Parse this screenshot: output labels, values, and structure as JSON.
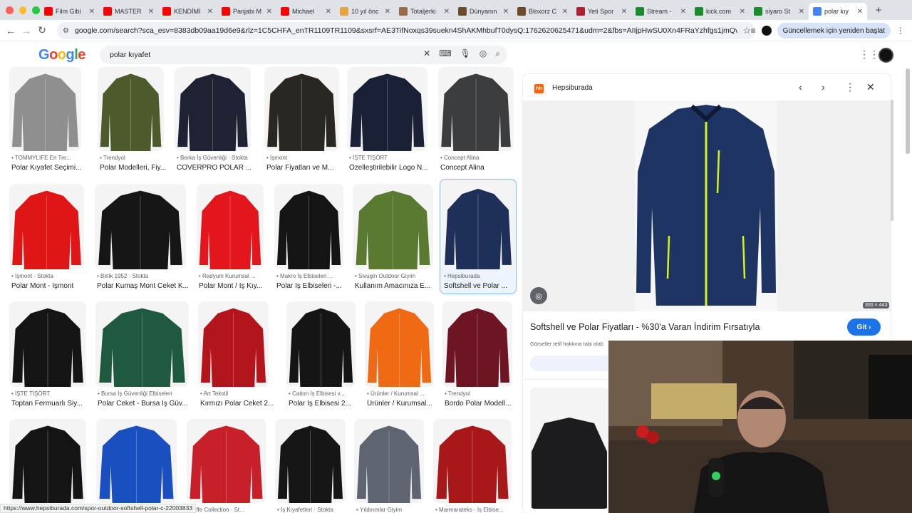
{
  "browser": {
    "tabs": [
      {
        "title": "Film Gibi",
        "favicon": "youtube-icon",
        "color": "#ff0000",
        "active": false
      },
      {
        "title": "MASTER",
        "favicon": "youtube-icon",
        "color": "#ff0000",
        "active": false
      },
      {
        "title": "KENDİMİ",
        "favicon": "youtube-icon",
        "color": "#ff0000",
        "active": false
      },
      {
        "title": "Panjabi M",
        "favicon": "youtube-icon",
        "color": "#ff0000",
        "active": false
      },
      {
        "title": "Michael",
        "favicon": "youtube-icon",
        "color": "#ff0000",
        "active": false
      },
      {
        "title": "10 yıl önc",
        "favicon": "chart-icon",
        "color": "#e8a33d",
        "active": false
      },
      {
        "title": "Totaljerki",
        "favicon": "page-icon",
        "color": "#9a6b4a",
        "active": false
      },
      {
        "title": "Dünyanın",
        "favicon": "shield-icon",
        "color": "#6b4b2a",
        "active": false
      },
      {
        "title": "Bloxorz C",
        "favicon": "shield-icon",
        "color": "#6b4b2a",
        "active": false
      },
      {
        "title": "Yeti Spor",
        "favicon": "vs-icon",
        "color": "#b02030",
        "active": false
      },
      {
        "title": "Stream -",
        "favicon": "kick-icon",
        "color": "#1b8c2b",
        "active": false
      },
      {
        "title": "kick.com",
        "favicon": "kick-icon",
        "color": "#1b8c2b",
        "active": false
      },
      {
        "title": "siyaro St",
        "favicon": "kick-icon",
        "color": "#1b8c2b",
        "active": false
      },
      {
        "title": "polar kıy",
        "favicon": "google-icon",
        "color": "#4285f4",
        "active": true
      }
    ],
    "url": "google.com/search?sca_esv=8383db09aa19d6e9&rlz=1C5CHFA_enTR1109TR1109&sxsrf=AE3TifNoxqs39suekn4ShAKMhbufT0dysQ:1762620625471&udm=2&fbs=AIIjpHwSU0Xn4FRaYzhfgs1jmQvOnw1dDD9...",
    "update_button": "Güncellemek için yeniden başlat",
    "status_url": "https://www.hepsiburada.com/spor-outdoor-softshell-polar-c-22003833"
  },
  "google": {
    "logo_letters": [
      "G",
      "o",
      "o",
      "g",
      "l",
      "e"
    ],
    "logo_colors": [
      "#4285f4",
      "#ea4335",
      "#fbbc05",
      "#4285f4",
      "#34a853",
      "#ea4335"
    ],
    "query": "polar kıyafet"
  },
  "results": [
    {
      "source": "TOMMYLIFE En Tre...",
      "title": "Polar Kıyafet Seçimi...",
      "color": "#8f8f8f",
      "icon": "brand-icon"
    },
    {
      "source": "Trendyol",
      "title": "Polar Modelleri, Fiy...",
      "color": "#4d5b2c",
      "icon": "trendyol-icon"
    },
    {
      "source": "Berka İş Güvenliği · Stokta",
      "title": "COVERPRO POLAR ...",
      "color": "#1f2233",
      "icon": "store-icon"
    },
    {
      "source": "İşmont",
      "title": "Polar Fiyatları ve M...",
      "color": "#2a2622",
      "icon": "store-icon"
    },
    {
      "source": "İŞTE TİŞÖRT",
      "title": "Özelleştirilebilir Logo N...",
      "color": "#1a2136",
      "icon": "store-icon"
    },
    {
      "source": "Concept Alina",
      "title": "Concept Alina",
      "color": "#3b3c3e",
      "icon": "store-icon"
    },
    {
      "source": "İşmont · Stokta",
      "title": "Polar Mont - İşmont",
      "color": "#e01616",
      "icon": "store-icon"
    },
    {
      "source": "Birlik 1952 · Stokta",
      "title": "Polar Kumaş Mont Ceket K...",
      "color": "#161616",
      "icon": "store-icon"
    },
    {
      "source": "Radyum Kurumsal ...",
      "title": "Polar Mont / İş Kıy...",
      "color": "#e3161e",
      "icon": "store-icon"
    },
    {
      "source": "Makro İş Elbiseleri ...",
      "title": "Polar İş Elbiseleri -...",
      "color": "#141414",
      "icon": "store-icon"
    },
    {
      "source": "Sivugin Outdoor Giyim",
      "title": "Kullanım Amacınıza E...",
      "color": "#5a7a32",
      "icon": "store-icon"
    },
    {
      "source": "Hepsiburada",
      "title": "Softshell ve Polar ...",
      "color": "#1e2f5a",
      "icon": "hepsiburada-icon"
    },
    {
      "source": "İŞTE TİŞÖRT",
      "title": "Toptan Fermuarlı Siy...",
      "color": "#141414",
      "icon": "store-icon"
    },
    {
      "source": "Bursa İş Güvenliği Elbiseleri",
      "title": "Polar Ceket - Bursa İş Güv...",
      "color": "#1f5a40",
      "icon": "store-icon"
    },
    {
      "source": "Art Tekstil",
      "title": "Kırmızı Polar Ceket 2...",
      "color": "#b4141c",
      "icon": "store-icon"
    },
    {
      "source": "Cation İş Elbisesi v...",
      "title": "Polar İş Elbisesi 2...",
      "color": "#151515",
      "icon": "store-icon"
    },
    {
      "source": "Ürünler / Kurumsal ...",
      "title": "Ürünler / Kurumsal...",
      "color": "#f06a14",
      "icon": "store-icon"
    },
    {
      "source": "Trendyol",
      "title": "Bordo Polar Modell...",
      "color": "#6e1524",
      "icon": "trendyol-icon"
    },
    {
      "source": "",
      "title": "",
      "color": "#141414",
      "icon": "store-icon"
    },
    {
      "source": "",
      "title": "",
      "color": "#1a4fc0",
      "icon": "store-icon"
    },
    {
      "source": "Effe Collection · St...",
      "title": "",
      "color": "#c8202a",
      "icon": "store-icon"
    },
    {
      "source": "İş Kıyafetleri · Stokta",
      "title": "",
      "color": "#161616",
      "icon": "store-icon"
    },
    {
      "source": "Yıldırımlar Giyim",
      "title": "",
      "color": "#5e6470",
      "icon": "store-icon"
    },
    {
      "source": "Marmarateks - İş Elbise...",
      "title": "",
      "color": "#a81818",
      "icon": "store-icon"
    }
  ],
  "panel": {
    "site": "Hepsiburada",
    "logo_text": "hb",
    "dimensions": "300 × 443",
    "title": "Softshell ve Polar Fiyatları - %30'a Varan İndirim Fırsatıyla",
    "visit_button": "Git ›",
    "copyright": "Görseller telif hakkına tabi olab",
    "accent": "#1a73e8",
    "jacket_color": "#1e3463",
    "zip_color": "#d6f21c"
  }
}
